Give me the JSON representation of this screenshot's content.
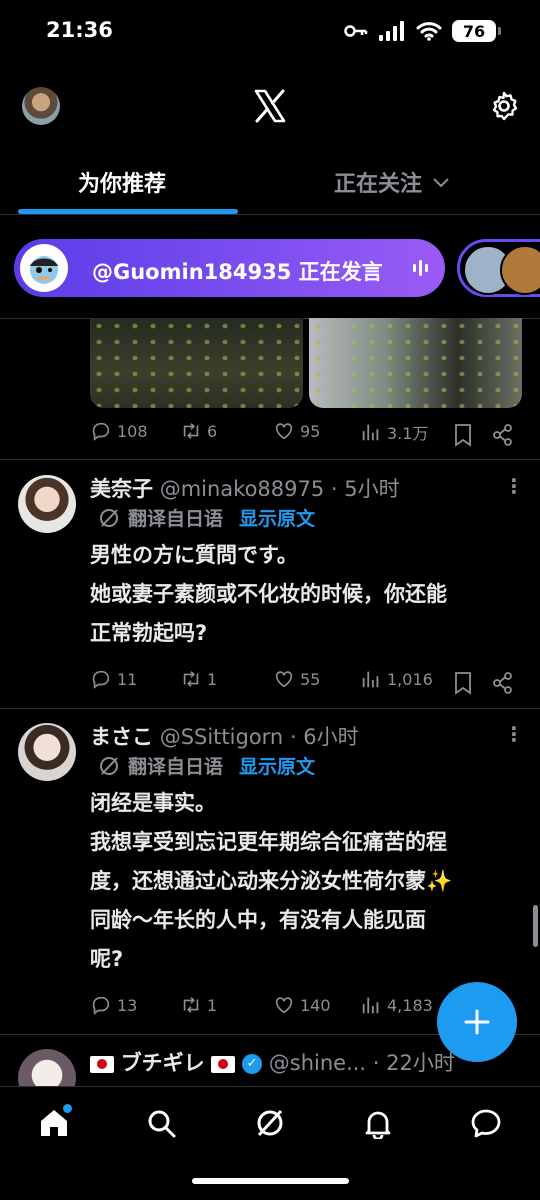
{
  "status_bar": {
    "time": "21:36",
    "battery": "76"
  },
  "tabs": [
    {
      "label": "为你推荐",
      "active": true
    },
    {
      "label": "正在关注",
      "active": false
    }
  ],
  "space": {
    "text": "@Guomin184935 正在发言"
  },
  "tweet0": {
    "replies": "108",
    "retweets": "6",
    "likes": "95",
    "views": "3.1万"
  },
  "tweets": [
    {
      "name": "美奈子",
      "handle": "@minako88975",
      "time": "· 5小时",
      "translate_label": "翻译自日语",
      "show_original": "显示原文",
      "lines": [
        "男性の方に質問です。",
        "她或妻子素颜或不化妆的时候，你还能",
        "正常勃起吗?"
      ],
      "replies": "11",
      "retweets": "1",
      "likes": "55",
      "views": "1,016"
    },
    {
      "name": "まさこ",
      "handle": "@SSittigorn",
      "time": "· 6小时",
      "translate_label": "翻译自日语",
      "show_original": "显示原文",
      "lines": [
        "闭经是事实。",
        "我想享受到忘记更年期综合征痛苦的程",
        "度，还想通过心动来分泌女性荷尔蒙✨",
        "同龄～年长的人中，有没有人能见面",
        "呢?"
      ],
      "replies": "13",
      "retweets": "1",
      "likes": "140",
      "views": "4,183"
    },
    {
      "name": "ブチギレ",
      "handle": "@shine...",
      "time": "· 22小时"
    }
  ],
  "colors": {
    "accent": "#1d9bf0",
    "space_gradient_start": "#5b3ce8",
    "space_gradient_end": "#9a5bf5",
    "muted": "#8b8f95"
  },
  "icons": {
    "home": "home-icon",
    "search": "search-icon",
    "grok": "grok-icon",
    "notifications": "bell-icon",
    "messages": "message-icon",
    "compose": "plus-icon"
  }
}
